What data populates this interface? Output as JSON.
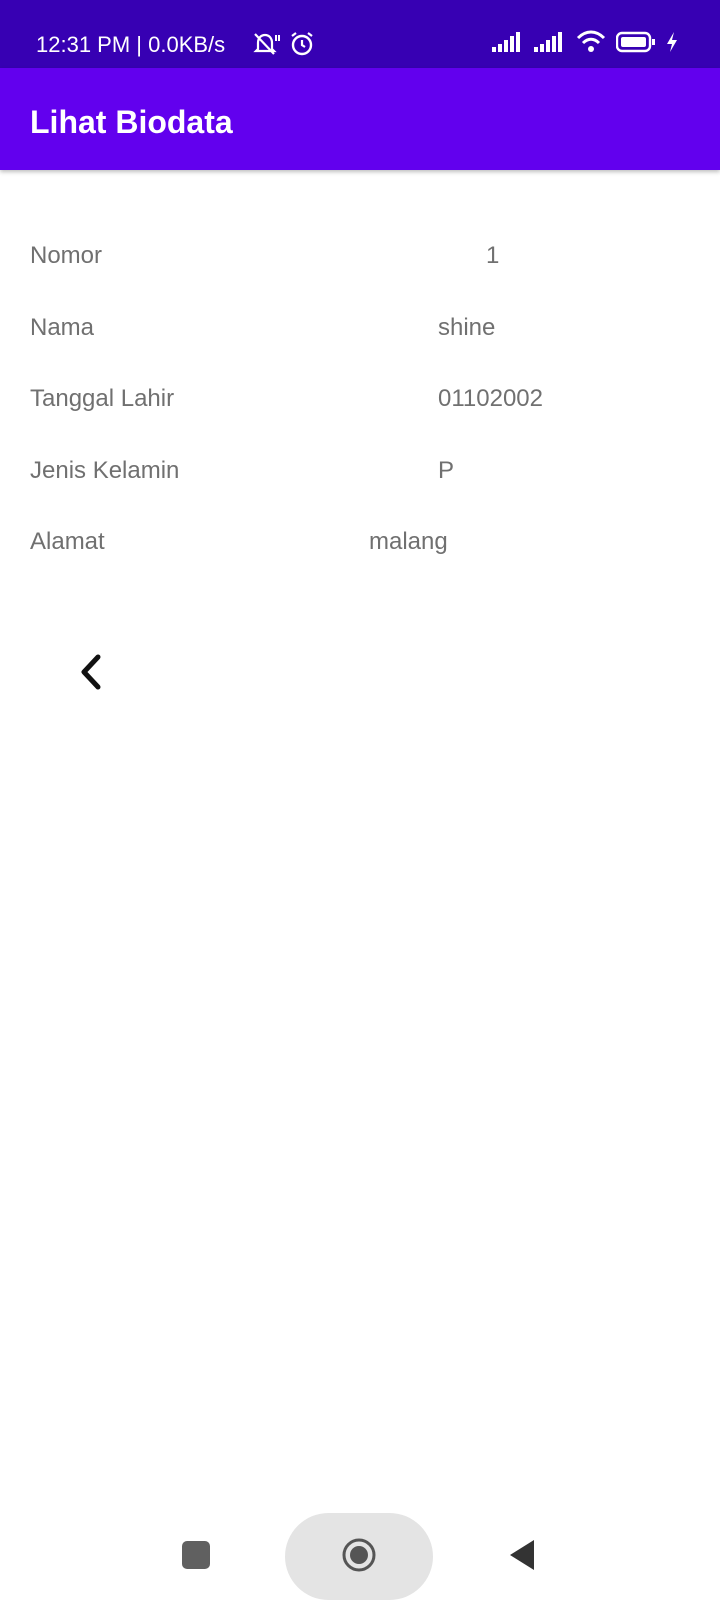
{
  "status_bar": {
    "time_text": "12:31 PM | 0.0KB/s",
    "icons_left": [
      "muted-bell-icon",
      "alarm-icon"
    ],
    "icons_right": [
      "signal-icon",
      "signal-icon",
      "wifi-icon",
      "battery-icon",
      "charging-icon"
    ]
  },
  "app_bar": {
    "title": "Lihat Biodata"
  },
  "fields": [
    {
      "label": "Nomor",
      "value": "1"
    },
    {
      "label": "Nama",
      "value": "shine"
    },
    {
      "label": "Tanggal Lahir",
      "value": "01102002"
    },
    {
      "label": "Jenis Kelamin",
      "value": "P"
    },
    {
      "label": "Alamat",
      "value": "malang"
    }
  ],
  "back_button": {
    "icon": "chevron-left-icon"
  },
  "nav_bar": {
    "icons": [
      "recents-icon",
      "home-icon",
      "back-icon"
    ]
  },
  "colors": {
    "status_bar": "#3700b3",
    "app_bar": "#6200ee",
    "text_gray": "#707070",
    "background": "#ffffff"
  }
}
